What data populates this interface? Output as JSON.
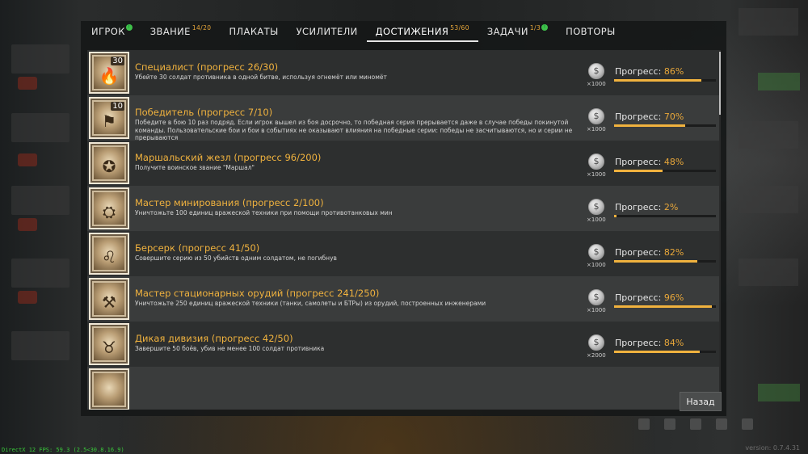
{
  "tabs": [
    {
      "label": "ИГРОК",
      "count": "",
      "has_dot": true,
      "active": false
    },
    {
      "label": "ЗВАНИЕ",
      "count": "14/20",
      "has_dot": false,
      "active": false
    },
    {
      "label": "ПЛАКАТЫ",
      "count": "",
      "has_dot": false,
      "active": false
    },
    {
      "label": "УСИЛИТЕЛИ",
      "count": "",
      "has_dot": false,
      "active": false
    },
    {
      "label": "ДОСТИЖЕНИЯ",
      "count": "53/60",
      "has_dot": false,
      "active": true
    },
    {
      "label": "ЗАДАЧИ",
      "count": "1/3",
      "has_dot": true,
      "active": false
    },
    {
      "label": "ПОВТОРЫ",
      "count": "",
      "has_dot": false,
      "active": false
    }
  ],
  "progress_label": "Прогресс:",
  "achievements": [
    {
      "title": "Специалист (прогресс 26/30)",
      "description": "Убейте 30 солдат противника в одной битве, используя огнемёт или миномёт",
      "reward": "×1000",
      "progress": "86%",
      "progress_value": 0.86,
      "badge_number": "30",
      "icon": "flamethrower-icon"
    },
    {
      "title": "Победитель (прогресс 7/10)",
      "description": "Победите в бою 10 раз подряд. Если игрок вышел из боя досрочно, то победная серия прерывается даже в случае победы покинутой команды. Пользовательские бои и бои в событиях не оказывают влияния на победные серии: победы не засчитываются, но и серии не прерываются",
      "reward": "×1000",
      "progress": "70%",
      "progress_value": 0.7,
      "badge_number": "10",
      "icon": "victory-flag-icon"
    },
    {
      "title": "Маршальский жезл (прогресс 96/200)",
      "description": "Получите воинское звание \"Маршал\"",
      "reward": "×1000",
      "progress": "48%",
      "progress_value": 0.48,
      "badge_number": "",
      "icon": "marshal-medal-icon"
    },
    {
      "title": "Мастер минирования (прогресс 2/100)",
      "description": "Уничтожьте 100 единиц вражеской техники при помощи противотанковых мин",
      "reward": "×1000",
      "progress": "2%",
      "progress_value": 0.02,
      "badge_number": "",
      "icon": "mine-icon"
    },
    {
      "title": "Берсерк (прогресс 41/50)",
      "description": "Совершите серию из 50 убийств одним солдатом, не погибнув",
      "reward": "×1000",
      "progress": "82%",
      "progress_value": 0.82,
      "badge_number": "",
      "icon": "lion-icon"
    },
    {
      "title": "Мастер стационарных орудий (прогресс 241/250)",
      "description": "Уничтожьте 250 единиц вражеской техники (танки, самолеты и БТРы) из орудий, построенных инженерами",
      "reward": "×1000",
      "progress": "96%",
      "progress_value": 0.96,
      "badge_number": "",
      "icon": "cannon-icon"
    },
    {
      "title": "Дикая дивизия (прогресс 42/50)",
      "description": "Завершите 50 боёв, убив не менее 100 солдат противника",
      "reward": "×2000",
      "progress": "84%",
      "progress_value": 0.84,
      "badge_number": "",
      "icon": "bear-icon"
    }
  ],
  "back_button": "Назад",
  "fps_text": "DirectX 12 FPS: 59.3 (2.5<30.8.16.9)",
  "version_text": "version: 0.7.4.31"
}
